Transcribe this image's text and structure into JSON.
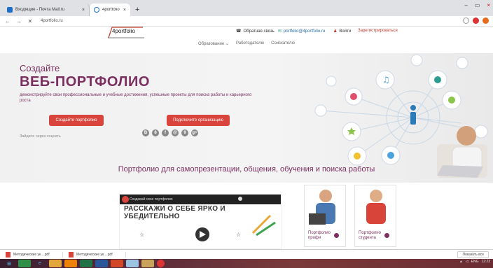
{
  "browser": {
    "tabs": [
      {
        "label": "Входящие - Почта Mail.ru",
        "close": "×"
      },
      {
        "label": "4portfolio - портал для ведени...",
        "close": "×"
      }
    ],
    "new_tab": "+",
    "window_controls": [
      "–",
      "▭",
      "×"
    ],
    "url": "4portfolio.ru",
    "back": "←",
    "forward": "→",
    "reload": "✕"
  },
  "site": {
    "logo_text": "4portfolio",
    "topnav": {
      "feedback": "Обратная связь",
      "email": "portfolio@4portfolio.ru",
      "login": "Войти",
      "register": "Зарегистрироваться"
    },
    "menu": [
      "Образование ⌄",
      "Работодателю",
      "Соискателю"
    ],
    "hero": {
      "subtitle": "Создайте",
      "title": "ВЕБ-ПОРТФОЛИО",
      "text": "демонстрируйте свои профессиональные и учебные достижения, успешные проекты для поиска работы и карьерного роста",
      "create_button": "Создайте портфолио",
      "org_button": "Подключите организацию",
      "social_label": "Зайдите через соцсеть",
      "socials": [
        "В",
        "8",
        "f",
        "@",
        "9",
        "g+"
      ]
    },
    "section_title": "Портфолио для самопрезентации, общения, обучения и поиска работы",
    "video": {
      "title": "Создавай свое портфолио",
      "caption": "РАССКАЖИ О СЕБЕ ЯРКО И УБЕДИТЕЛЬНО"
    },
    "cards": [
      {
        "label_line1": "Портфолио",
        "label_line2": "профи"
      },
      {
        "label_line1": "Портфолио",
        "label_line2": "студента"
      }
    ]
  },
  "downloads": {
    "items": [
      "Методические ук....pdf",
      "Методические ук....pdf"
    ],
    "show_all": "Показать все"
  },
  "taskbar": {
    "lang": "ENG",
    "time": "12:23"
  },
  "colors": {
    "brand": "#7a2f60",
    "accent": "#d9443c"
  }
}
